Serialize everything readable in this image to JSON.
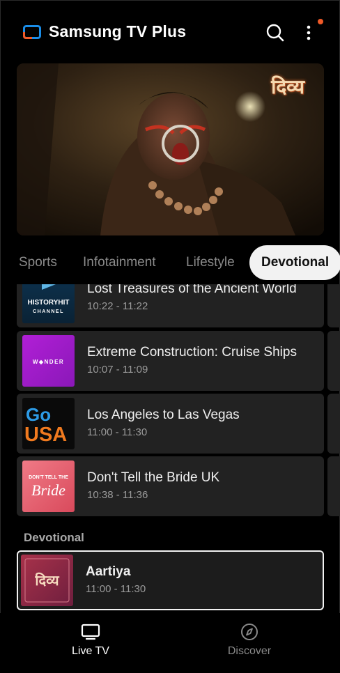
{
  "header": {
    "app_title": "Samsung TV Plus",
    "logo_icon": "tv-logo-icon",
    "search_icon": "search-icon",
    "more_icon": "more-vertical-icon",
    "notification_dot_color": "#f05a28"
  },
  "hero": {
    "channel_logo_text": "दिव्य"
  },
  "tabs": [
    {
      "label": "Sports",
      "active": false
    },
    {
      "label": "Infotainment",
      "active": false
    },
    {
      "label": "Lifestyle",
      "active": false
    },
    {
      "label": "Devotional",
      "active": true
    }
  ],
  "rows": [
    {
      "title": "Lost Treasures of the Ancient World",
      "time": "10:22 - 11:22",
      "thumb_line1": "HISTORYHIT",
      "thumb_line2": "CHANNEL"
    },
    {
      "title": "Extreme Construction: Cruise Ships",
      "time": "10:07 - 11:09",
      "thumb_line1": "W◆NDER"
    },
    {
      "title": "Los Angeles to Las Vegas",
      "time": "11:00 - 11:30",
      "thumb_line1": "Go",
      "thumb_line2": "USA"
    },
    {
      "title": "Don't Tell the Bride UK",
      "time": "10:38 - 11:36",
      "thumb_line1": "DON'T TELL THE",
      "thumb_line2": "Bride"
    }
  ],
  "section": {
    "label": "Devotional",
    "selected_row": {
      "title": "Aartiya",
      "time": "11:00 - 11:30",
      "thumb_line1": "दिव्य"
    }
  },
  "bottom_nav": [
    {
      "label": "Live TV",
      "icon": "tv-icon",
      "active": true
    },
    {
      "label": "Discover",
      "icon": "compass-icon",
      "active": false
    }
  ],
  "colors": {
    "background": "#000000",
    "card": "#222222",
    "active_tab_bg": "#f2f2f2",
    "logo_blue": "#1a8de8",
    "logo_orange": "#f05a28"
  }
}
